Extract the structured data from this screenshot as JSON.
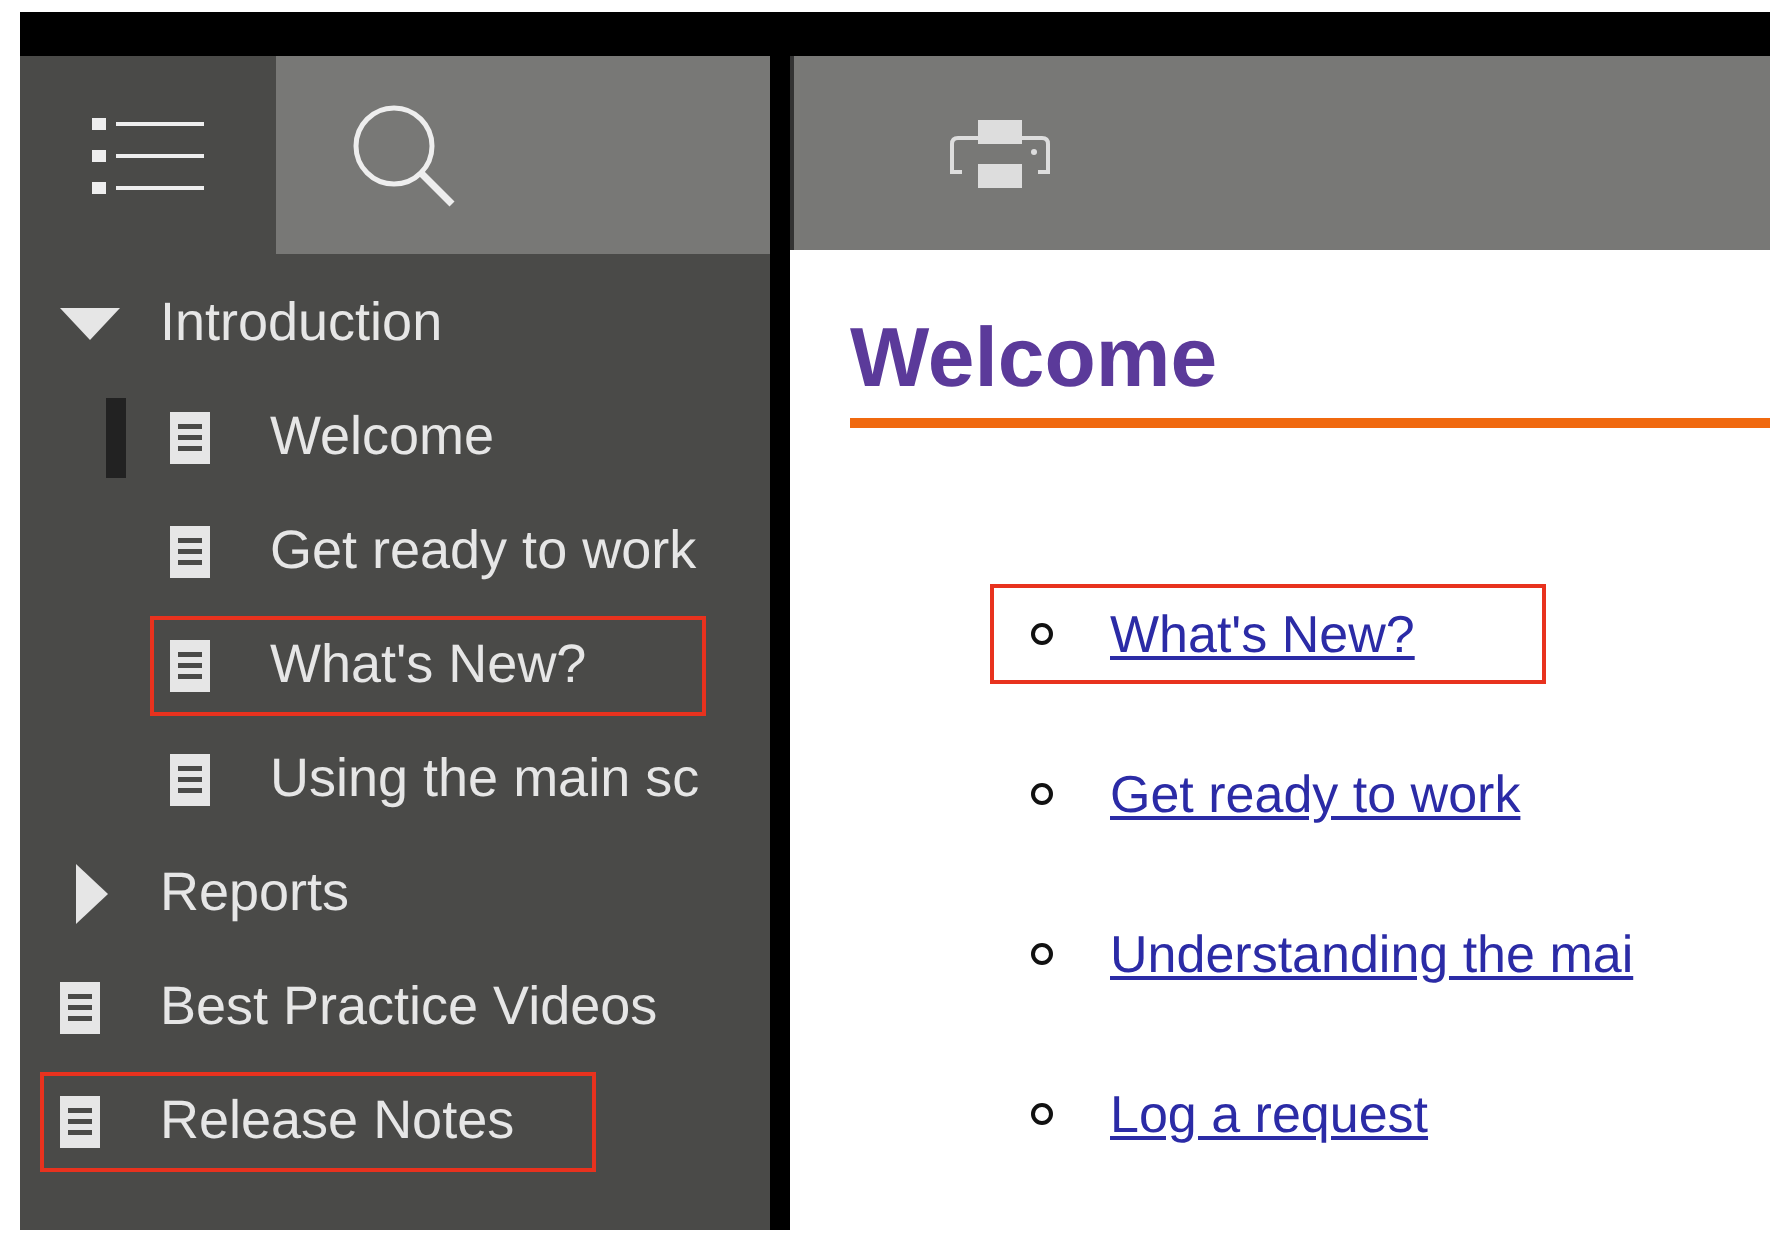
{
  "sidebar": {
    "tabs": [
      {
        "kind": "contents",
        "selected": true
      },
      {
        "kind": "search",
        "selected": false
      }
    ],
    "tree": [
      {
        "kind": "folder",
        "label": "Introduction",
        "expanded": true,
        "highlighted": false,
        "children": [
          {
            "kind": "page",
            "label": "Welcome",
            "selected": true,
            "highlighted": false
          },
          {
            "kind": "page",
            "label": "Get ready to work",
            "selected": false,
            "highlighted": false
          },
          {
            "kind": "page",
            "label": "What's New?",
            "selected": false,
            "highlighted": true
          },
          {
            "kind": "page",
            "label": "Using the main sc",
            "selected": false,
            "highlighted": false
          }
        ]
      },
      {
        "kind": "folder",
        "label": "Reports",
        "expanded": false,
        "highlighted": false
      },
      {
        "kind": "page",
        "label": "Best Practice Videos",
        "selected": false,
        "highlighted": false
      },
      {
        "kind": "page",
        "label": "Release Notes",
        "selected": false,
        "highlighted": true
      }
    ]
  },
  "content": {
    "heading": "Welcome",
    "links": [
      {
        "label": "What's New?",
        "highlighted": true
      },
      {
        "label": "Get ready to work",
        "highlighted": false
      },
      {
        "label": "Understanding the mai",
        "highlighted": false
      },
      {
        "label": "Log a request",
        "highlighted": false
      }
    ]
  }
}
